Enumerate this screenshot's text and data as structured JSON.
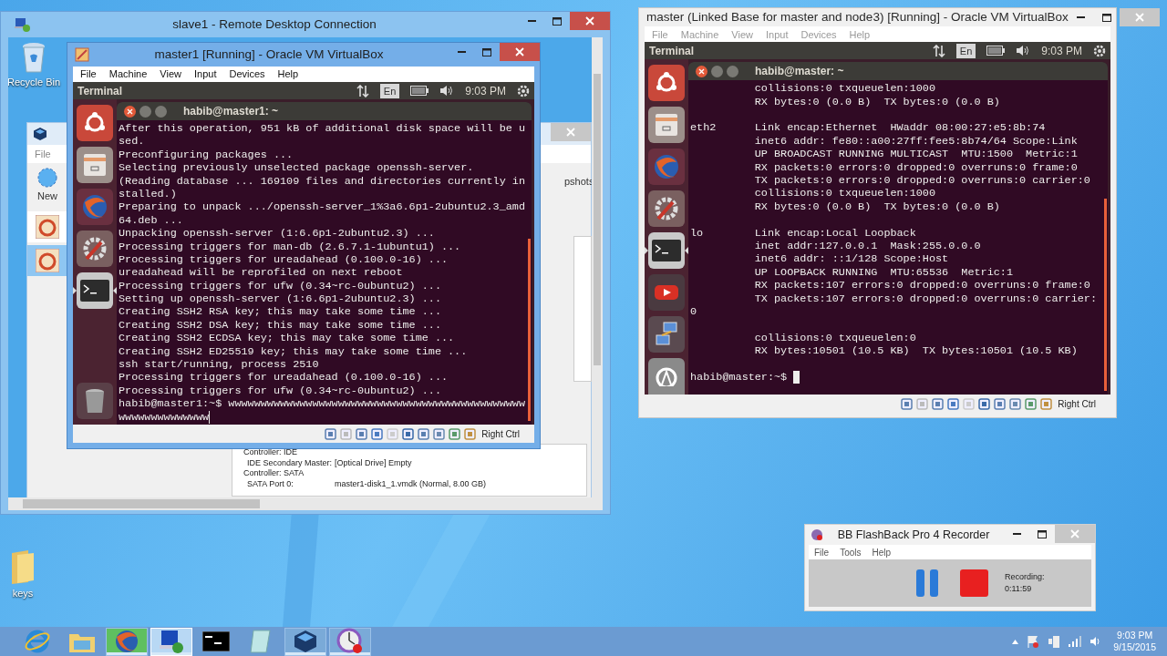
{
  "desktop_icons": [
    {
      "label": "keys",
      "kind": "folder"
    }
  ],
  "rdp_window": {
    "title": "slave1 - Remote Desktop Connection",
    "remote_desktop_icons": [
      {
        "label": "Recycle Bin",
        "kind": "recycle-bin"
      }
    ],
    "manager": {
      "menu": [
        "File"
      ],
      "toolbar": [
        "New"
      ],
      "tab": "pshots",
      "vm_list": [
        {
          "selected": false
        },
        {
          "selected": true
        }
      ],
      "details": [
        {
          "label": "Controller: IDE"
        },
        {
          "label": "IDE Secondary Master:",
          "value": "[Optical Drive] Empty"
        },
        {
          "label": "Controller: SATA"
        },
        {
          "label": "SATA Port 0:",
          "value": "master1-disk1_1.vmdk (Normal, 8.00 GB)"
        }
      ]
    },
    "guest_vm": {
      "title": "master1 [Running] - Oracle VM VirtualBox",
      "active": true,
      "menu": [
        "File",
        "Machine",
        "View",
        "Input",
        "Devices",
        "Help"
      ],
      "panel": {
        "app": "Terminal",
        "lang": "En",
        "time": "9:03 PM"
      },
      "launcher": [
        {
          "kind": "ubuntu",
          "running": false
        },
        {
          "kind": "files",
          "running": false
        },
        {
          "kind": "browser",
          "running": false
        },
        {
          "kind": "settings",
          "running": false
        },
        {
          "kind": "terminal",
          "running": true
        },
        {
          "kind": "trash",
          "running": false
        }
      ],
      "terminal": {
        "title": "habib@master1: ~",
        "block_cursor": false,
        "blocks": [
          [
            "After this operation, 951 kB of additional disk space will be u",
            "sed.",
            "Preconfiguring packages ...",
            "Selecting previously unselected package openssh-server.",
            "(Reading database ... 169109 files and directories currently in",
            "stalled.)",
            "Preparing to unpack .../openssh-server_1%3a6.6p1-2ubuntu2.3_amd",
            "64.deb ...",
            "Unpacking openssh-server (1:6.6p1-2ubuntu2.3) ...",
            "Processing triggers for man-db (2.6.7.1-1ubuntu1) ...",
            "Processing triggers for ureadahead (0.100.0-16) ...",
            "ureadahead will be reprofiled on next reboot",
            "Processing triggers for ufw (0.34~rc-0ubuntu2) ...",
            "Setting up openssh-server (1:6.6p1-2ubuntu2.3) ...",
            "Creating SSH2 RSA key; this may take some time ...",
            "Creating SSH2 DSA key; this may take some time ...",
            "Creating SSH2 ECDSA key; this may take some time ...",
            "Creating SSH2 ED25519 key; this may take some time ...",
            "ssh start/running, process 2510",
            "Processing triggers for ureadahead (0.100.0-16) ...",
            "Processing triggers for ufw (0.34~rc-0ubuntu2) ...",
            "habib@master1:~$ wwwwwwwwwwwwwwwwwwwwwwwwwwwwwwwwwwwwwwwwwwwwww",
            "wwwwwwwwwwwwww"
          ]
        ]
      },
      "host_key": "Right Ctrl"
    }
  },
  "vm_window": {
    "title": "master (Linked Base for master and node3) [Running] - Oracle VM VirtualBox",
    "active": false,
    "menu": [
      "File",
      "Machine",
      "View",
      "Input",
      "Devices",
      "Help"
    ],
    "panel": {
      "app": "Terminal",
      "lang": "En",
      "time": "9:03 PM"
    },
    "launcher": [
      {
        "kind": "ubuntu",
        "running": false
      },
      {
        "kind": "files",
        "running": false
      },
      {
        "kind": "browser",
        "running": false
      },
      {
        "kind": "settings",
        "running": false
      },
      {
        "kind": "terminal",
        "running": true
      },
      {
        "kind": "video",
        "running": false
      },
      {
        "kind": "network",
        "running": false
      },
      {
        "kind": "software",
        "running": false
      }
    ],
    "terminal": {
      "title": "habib@master: ~",
      "block_cursor": true,
      "blocks": [
        [
          "          collisions:0 txqueuelen:1000",
          "          RX bytes:0 (0.0 B)  TX bytes:0 (0.0 B)"
        ],
        [
          "eth2      Link encap:Ethernet  HWaddr 08:00:27:e5:8b:74",
          "          inet6 addr: fe80::a00:27ff:fee5:8b74/64 Scope:Link",
          "          UP BROADCAST RUNNING MULTICAST  MTU:1500  Metric:1",
          "          RX packets:0 errors:0 dropped:0 overruns:0 frame:0",
          "          TX packets:0 errors:0 dropped:0 overruns:0 carrier:0",
          "          collisions:0 txqueuelen:1000",
          "          RX bytes:0 (0.0 B)  TX bytes:0 (0.0 B)"
        ],
        [
          "lo        Link encap:Local Loopback",
          "          inet addr:127.0.0.1  Mask:255.0.0.0",
          "          inet6 addr: ::1/128 Scope:Host",
          "          UP LOOPBACK RUNNING  MTU:65536  Metric:1",
          "          RX packets:107 errors:0 dropped:0 overruns:0 frame:0",
          "          TX packets:107 errors:0 dropped:0 overruns:0 carrier:",
          "0"
        ],
        [
          "          collisions:0 txqueuelen:0",
          "          RX bytes:10501 (10.5 KB)  TX bytes:10501 (10.5 KB)"
        ],
        [
          "habib@master:~$ "
        ]
      ]
    },
    "host_key": "Right Ctrl"
  },
  "recorder": {
    "title": "BB FlashBack Pro 4 Recorder",
    "menu": [
      "File",
      "Tools",
      "Help"
    ],
    "status_label": "Recording:",
    "elapsed": "0:11:59"
  },
  "taskbar": {
    "apps": [
      {
        "kind": "ie",
        "running": false,
        "selected": false,
        "attention": false
      },
      {
        "kind": "explorer",
        "running": false,
        "selected": false,
        "attention": false
      },
      {
        "kind": "firefox",
        "running": true,
        "selected": false,
        "attention": true
      },
      {
        "kind": "remote-desktop",
        "running": true,
        "selected": true,
        "attention": false
      },
      {
        "kind": "console",
        "running": false,
        "selected": false,
        "attention": false
      },
      {
        "kind": "notepad",
        "running": false,
        "selected": false,
        "attention": false
      },
      {
        "kind": "virtualbox",
        "running": true,
        "selected": false,
        "attention": false
      },
      {
        "kind": "recorder",
        "running": true,
        "selected": false,
        "attention": false
      }
    ],
    "clock": {
      "time": "9:03 PM",
      "date": "9/15/2015"
    }
  }
}
